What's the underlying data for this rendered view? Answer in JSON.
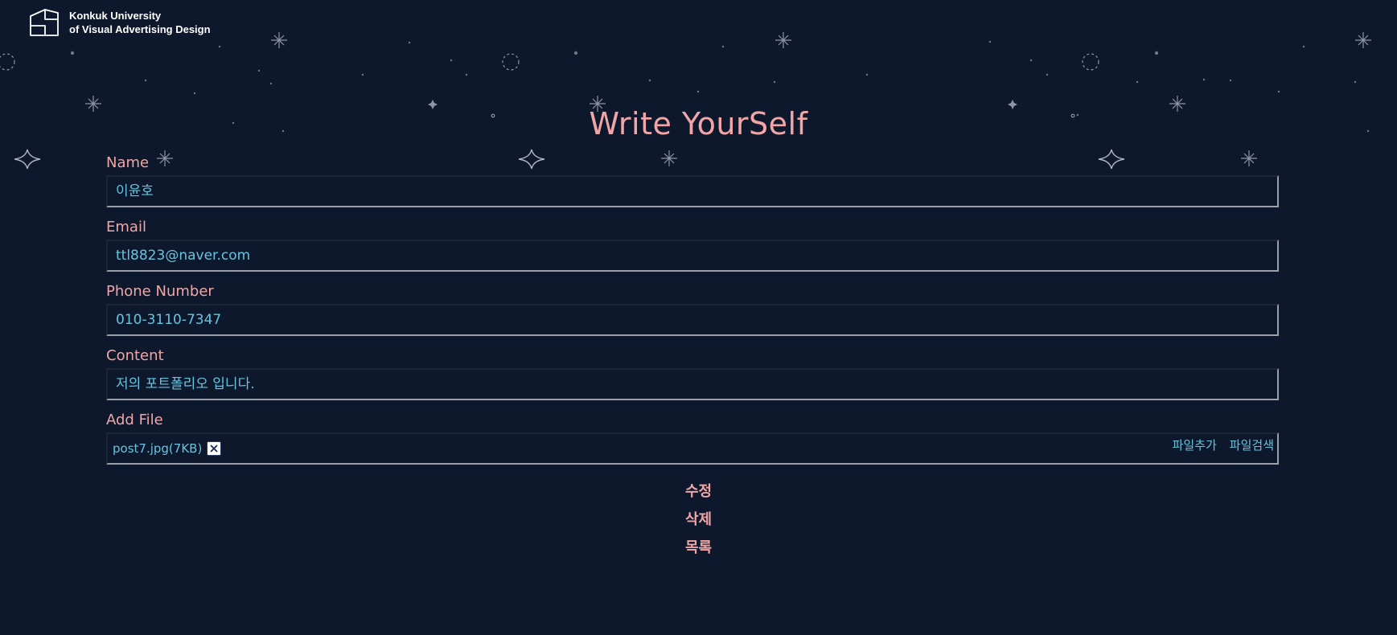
{
  "brand": {
    "line1": "Konkuk University",
    "line2": "of Visual Advertising Design",
    "logo_icon": "folded-box-logo-icon"
  },
  "page_title": "Write YourSelf",
  "form": {
    "name": {
      "label": "Name",
      "value": "이윤호"
    },
    "email": {
      "label": "Email",
      "value": "ttl8823@naver.com"
    },
    "phone": {
      "label": "Phone Number",
      "value": "010-3110-7347"
    },
    "content": {
      "label": "Content",
      "value": "저의 포트폴리오 입니다."
    },
    "file": {
      "label": "Add File",
      "file_name": "post7.jpg(7KB)",
      "remove_icon": "close-icon",
      "add_label": "파일추가",
      "search_label": "파일검색"
    }
  },
  "actions": {
    "edit": "수정",
    "delete": "삭제",
    "list": "목록"
  },
  "colors": {
    "background": "#0e182c",
    "accent_pink": "#f0a6a6",
    "value_cyan": "#66c4df",
    "star_gray": "#8e96a6"
  }
}
